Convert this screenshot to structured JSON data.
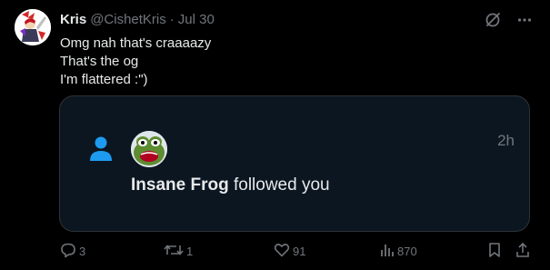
{
  "tweet": {
    "author_name": "Kris",
    "author_handle": "@CishetKris",
    "separator": "·",
    "date": "Jul 30",
    "lines": [
      "Omg nah that's craaaazy",
      "That's the og",
      "I'm flattered :\")"
    ]
  },
  "quote": {
    "time_ago": "2h",
    "follower_name": "Insane Frog",
    "action_text": "followed you"
  },
  "actions": {
    "replies": "3",
    "reposts": "1",
    "likes": "91",
    "views": "870"
  },
  "colors": {
    "background": "#000000",
    "card_background": "#0b1620",
    "accent": "#1d9bf0",
    "muted": "#71767b",
    "text": "#e7e9ea"
  },
  "icons": [
    "grok-icon",
    "more-icon",
    "person-icon",
    "reply-icon",
    "repost-icon",
    "like-icon",
    "views-icon",
    "bookmark-icon",
    "share-icon"
  ]
}
